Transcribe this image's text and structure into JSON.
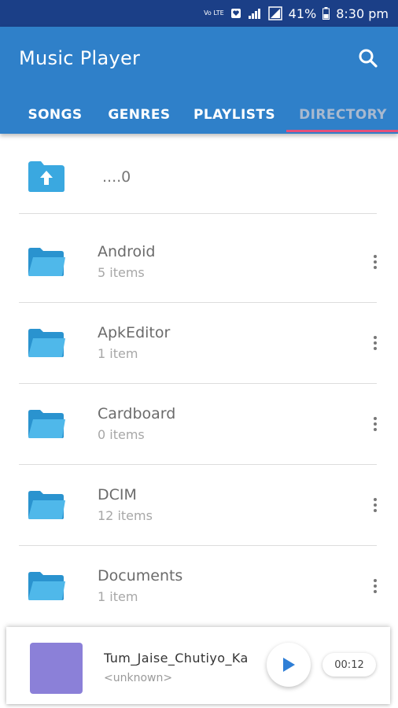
{
  "status_bar": {
    "battery": "41%",
    "time": "8:30 pm",
    "network_label": "Vo LTE"
  },
  "app": {
    "title": "Music Player"
  },
  "tabs": [
    {
      "label": "SONGS",
      "active": false
    },
    {
      "label": "GENRES",
      "active": false
    },
    {
      "label": "PLAYLISTS",
      "active": false
    },
    {
      "label": "DIRECTORY",
      "active": true
    }
  ],
  "colors": {
    "app_bar": "#2f80c9",
    "status_bar": "#1b3f87",
    "tab_indicator": "#e5507a",
    "folder": "#3aa8e0",
    "album_art": "#8b80d8",
    "play_icon": "#2f7fd6"
  },
  "directory": {
    "parent_label": "....0",
    "folders": [
      {
        "name": "Android",
        "count": "5 items"
      },
      {
        "name": "ApkEditor",
        "count": "1 item"
      },
      {
        "name": "Cardboard",
        "count": "0 items"
      },
      {
        "name": "DCIM",
        "count": "12 items"
      },
      {
        "name": "Documents",
        "count": "1 item"
      }
    ]
  },
  "now_playing": {
    "title": "Tum_Jaise_Chutiyo_Ka",
    "artist": "<unknown>",
    "elapsed": "00:12"
  },
  "icons": {
    "search": "search-icon",
    "folder": "folder-icon",
    "up_folder": "folder-up-icon",
    "more": "more-vert-icon",
    "play": "play-icon"
  }
}
